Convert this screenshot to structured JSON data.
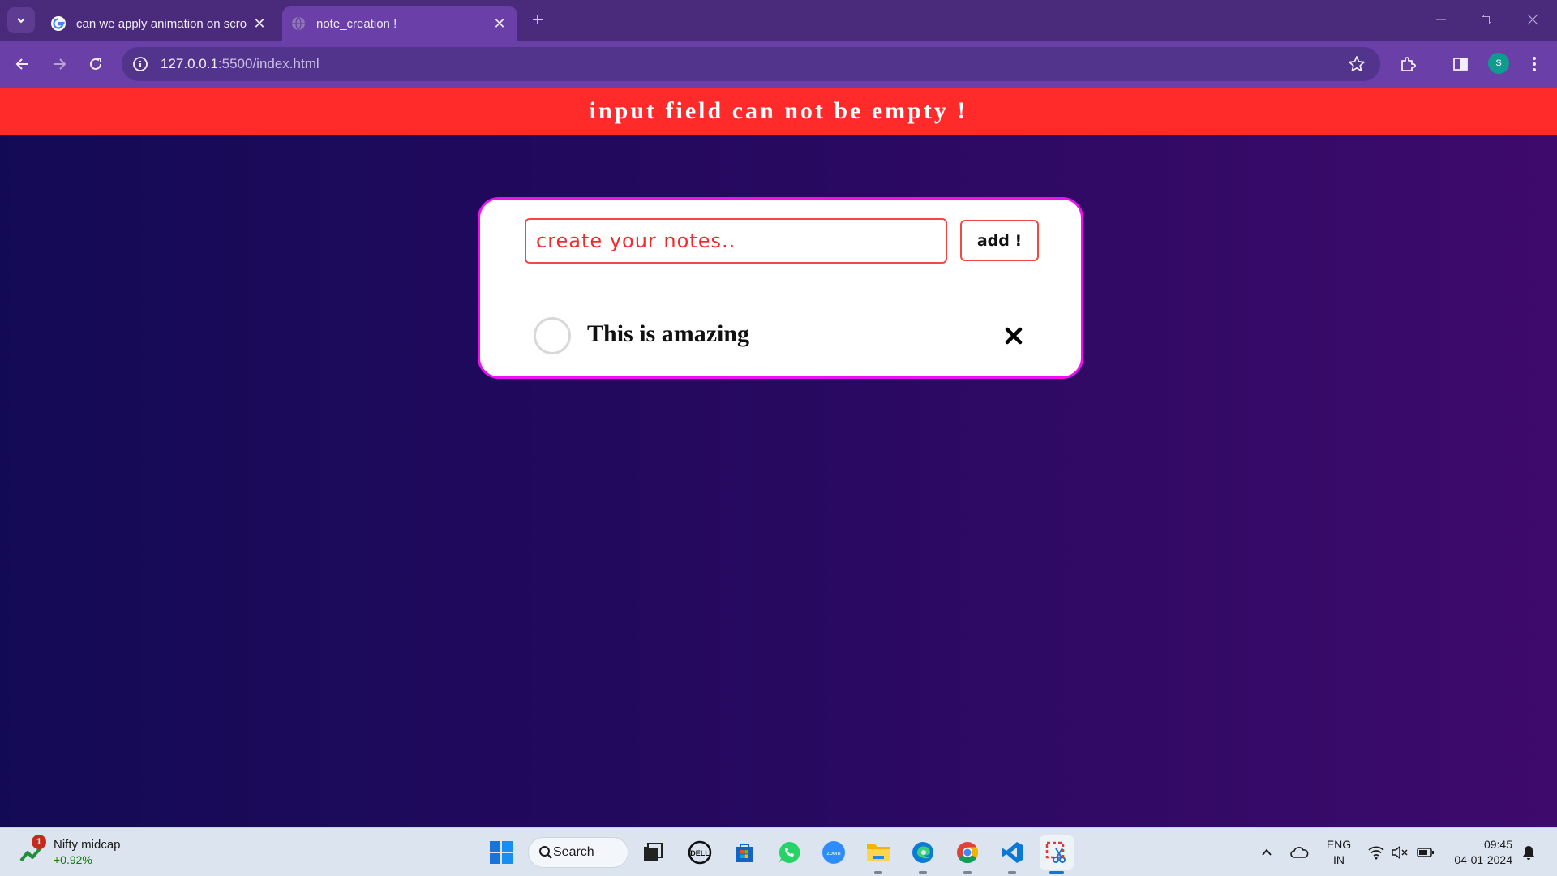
{
  "browser": {
    "tabs": [
      {
        "title": "can we apply animation on scro",
        "active": false,
        "icon": "google-icon"
      },
      {
        "title": "note_creation !",
        "active": true,
        "icon": "globe-icon"
      }
    ],
    "url_host": "127.0.0.1",
    "url_rest": ":5500/index.html",
    "profile_initial": "S"
  },
  "page": {
    "error_message": "input field can not be empty !",
    "input_placeholder": "create your notes..",
    "input_value": "",
    "add_label": "add !",
    "notes": [
      {
        "text": "This is amazing",
        "checked": false
      }
    ]
  },
  "taskbar": {
    "widget_title": "Nifty midcap",
    "widget_value": "+0.92%",
    "widget_badge": "1",
    "search_label": "Search",
    "lang_line1": "ENG",
    "lang_line2": "IN",
    "time": "09:45",
    "date": "04-01-2024"
  },
  "colors": {
    "error_banner": "#ff2a2a",
    "card_border": "#ee10ee",
    "input_border": "#f04848",
    "browser_tab": "#6a3fa8"
  }
}
